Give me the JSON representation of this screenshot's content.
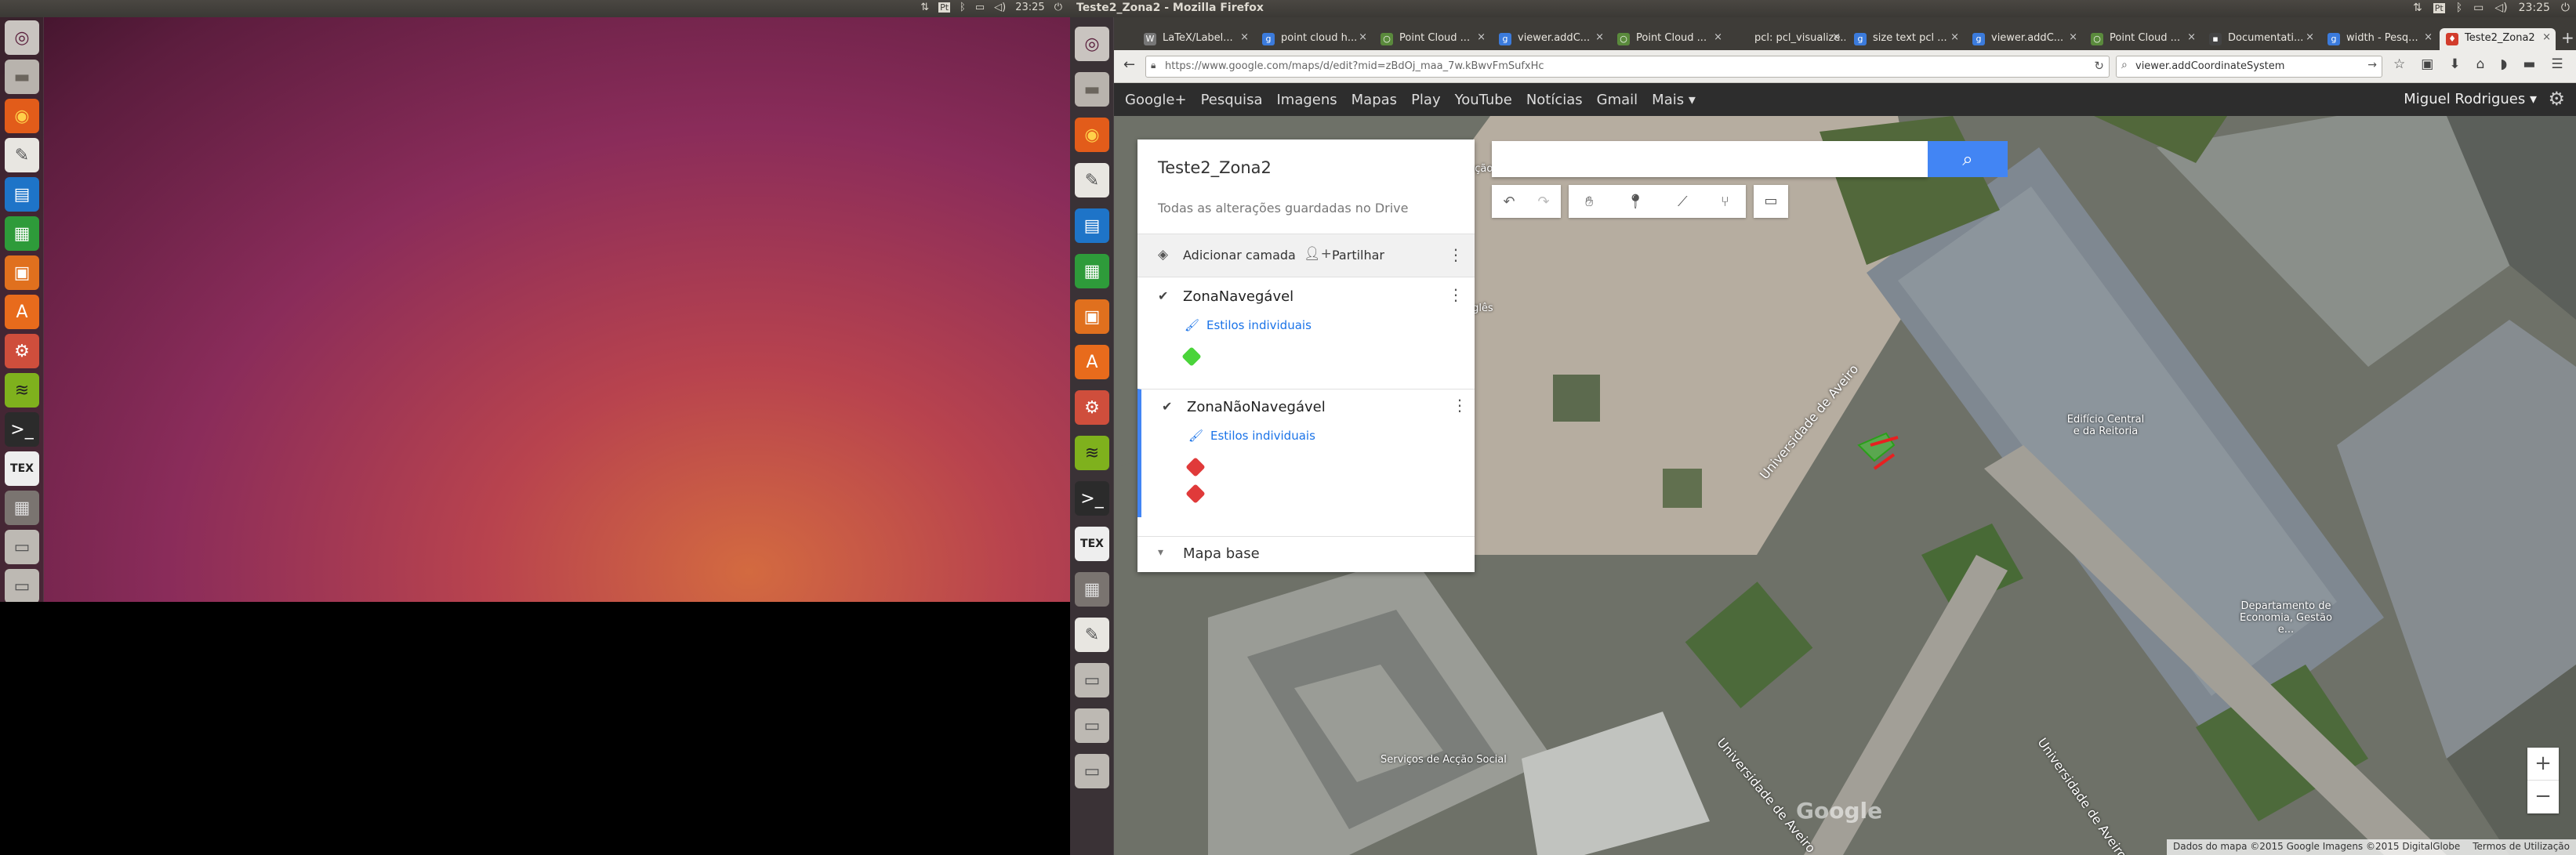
{
  "top_panel_left": {
    "time": "23:25"
  },
  "top_panel_right": {
    "window_title": "Teste2_Zona2 - Mozilla Firefox",
    "time": "23:25"
  },
  "launcher_left": [
    {
      "name": "dash-icon",
      "glyph": "◎",
      "bg": "#c9c4c0",
      "fg": "#5a1f3c"
    },
    {
      "name": "files-icon",
      "glyph": "▬",
      "bg": "#b8b3ad",
      "fg": "#6b655d"
    },
    {
      "name": "firefox-icon",
      "glyph": "◉",
      "bg": "#e25c1a",
      "fg": "#ffd04a"
    },
    {
      "name": "text-editor-icon",
      "glyph": "✎",
      "bg": "#e8e6e1",
      "fg": "#555"
    },
    {
      "name": "writer-icon",
      "glyph": "▤",
      "bg": "#1e74c8",
      "fg": "#fff"
    },
    {
      "name": "calc-icon",
      "glyph": "▦",
      "bg": "#2e9b3a",
      "fg": "#fff"
    },
    {
      "name": "impress-icon",
      "glyph": "▣",
      "bg": "#e0701e",
      "fg": "#fff"
    },
    {
      "name": "software-center-icon",
      "glyph": "A",
      "bg": "#e86b1c",
      "fg": "#fff"
    },
    {
      "name": "settings-icon",
      "glyph": "⚙",
      "bg": "#cf4e3c",
      "fg": "#fff"
    },
    {
      "name": "spotify-icon",
      "glyph": "≋",
      "bg": "#7fb11d",
      "fg": "#222"
    },
    {
      "name": "terminal-icon",
      "glyph": ">_",
      "bg": "#2b2b2b",
      "fg": "#fff"
    },
    {
      "name": "texmaker-icon",
      "glyph": "TEX",
      "bg": "#eeeeee",
      "fg": "#222"
    },
    {
      "name": "workspace-switcher-icon",
      "glyph": "▦",
      "bg": "#7a7470",
      "fg": "#ddd"
    },
    {
      "name": "drive-icon",
      "glyph": "▭",
      "bg": "#bdb9b3",
      "fg": "#555"
    },
    {
      "name": "drive-icon-2",
      "glyph": "▭",
      "bg": "#bdb9b3",
      "fg": "#555"
    }
  ],
  "launcher_right": [
    {
      "name": "dash-icon",
      "glyph": "◎",
      "bg": "#c9c4c0",
      "fg": "#5a1f3c"
    },
    {
      "name": "files-icon",
      "glyph": "▬",
      "bg": "#b8b3ad",
      "fg": "#6b655d"
    },
    {
      "name": "firefox-icon",
      "glyph": "◉",
      "bg": "#e25c1a",
      "fg": "#ffd04a"
    },
    {
      "name": "text-editor-icon",
      "glyph": "✎",
      "bg": "#e8e6e1",
      "fg": "#555"
    },
    {
      "name": "writer-icon",
      "glyph": "▤",
      "bg": "#1e74c8",
      "fg": "#fff"
    },
    {
      "name": "calc-icon",
      "glyph": "▦",
      "bg": "#2e9b3a",
      "fg": "#fff"
    },
    {
      "name": "impress-icon",
      "glyph": "▣",
      "bg": "#e0701e",
      "fg": "#fff"
    },
    {
      "name": "software-center-icon",
      "glyph": "A",
      "bg": "#e86b1c",
      "fg": "#fff"
    },
    {
      "name": "settings-icon",
      "glyph": "⚙",
      "bg": "#cf4e3c",
      "fg": "#fff"
    },
    {
      "name": "spotify-icon",
      "glyph": "≋",
      "bg": "#7fb11d",
      "fg": "#222"
    },
    {
      "name": "terminal-icon",
      "glyph": ">_",
      "bg": "#2b2b2b",
      "fg": "#fff"
    },
    {
      "name": "texmaker-icon",
      "glyph": "TEX",
      "bg": "#eeeeee",
      "fg": "#222"
    },
    {
      "name": "workspace-switcher-icon",
      "glyph": "▦",
      "bg": "#7a7470",
      "fg": "#ddd"
    },
    {
      "name": "text-editor-icon-2",
      "glyph": "✎",
      "bg": "#e8e6e1",
      "fg": "#555"
    },
    {
      "name": "drive-icon",
      "glyph": "▭",
      "bg": "#bdb9b3",
      "fg": "#555"
    },
    {
      "name": "drive-icon-2",
      "glyph": "▭",
      "bg": "#bdb9b3",
      "fg": "#555"
    },
    {
      "name": "drive-icon-3",
      "glyph": "▭",
      "bg": "#bdb9b3",
      "fg": "#555"
    }
  ],
  "tabs": [
    {
      "label": "LaTeX/Label...",
      "fav": "W",
      "fav_bg": "#777"
    },
    {
      "label": "point cloud h...",
      "fav": "g",
      "fav_bg": "#3b7bdc"
    },
    {
      "label": "Point Cloud ...",
      "fav": "○",
      "fav_bg": "#5a8a3c"
    },
    {
      "label": "viewer.addC...",
      "fav": "g",
      "fav_bg": "#3b7bdc"
    },
    {
      "label": "Point Cloud ...",
      "fav": "○",
      "fav_bg": "#5a8a3c"
    },
    {
      "label": "pcl: pcl_visualize...",
      "fav": "",
      "fav_bg": "transparent"
    },
    {
      "label": "size text pcl ...",
      "fav": "g",
      "fav_bg": "#3b7bdc"
    },
    {
      "label": "viewer.addC...",
      "fav": "g",
      "fav_bg": "#3b7bdc"
    },
    {
      "label": "Point Cloud ...",
      "fav": "○",
      "fav_bg": "#5a8a3c"
    },
    {
      "label": "Documentati...",
      "fav": "▪",
      "fav_bg": "#444"
    },
    {
      "label": "width - Pesq...",
      "fav": "g",
      "fav_bg": "#3b7bdc"
    },
    {
      "label": "Teste2_Zona2",
      "fav": "♦",
      "fav_bg": "#d23c2c",
      "active": true
    }
  ],
  "navbar": {
    "url": "https://www.google.com/maps/d/edit?mid=zBdOj_maa_7w.kBwvFmSufxHc",
    "search": "viewer.addCoordinateSystem"
  },
  "google_bar": {
    "links": [
      "Google+",
      "Pesquisa",
      "Imagens",
      "Mapas",
      "Play",
      "YouTube",
      "Notícias",
      "Gmail",
      "Mais ▾"
    ],
    "user": "Miguel Rodrigues ▾"
  },
  "panel": {
    "title": "Teste2_Zona2",
    "saved_status": "Todas as alterações guardadas no Drive",
    "add_layer": "Adicionar camada",
    "share": "Partilhar",
    "layers": [
      {
        "name": "ZonaNavegável",
        "style": "Estilos individuais",
        "color": "#4ad43a",
        "shapes": 1
      },
      {
        "name": "ZonaNãoNavegável",
        "style": "Estilos individuais",
        "color": "#e03a3a",
        "shapes": 2
      }
    ],
    "base_map": "Mapa base"
  },
  "map_labels": {
    "central": "Edifício Central\ne da Reitoria",
    "dept": "Departamento de\nEconomia, Gestão e...",
    "social": "Serviços de Acção Social",
    "street1": "Universidade de Aveiro",
    "street2": "Universidade de Aveiro",
    "street3": "Universidade de Aveiro",
    "educacao": "de Educação",
    "ingles": "Inglês",
    "footer_data": "Dados do mapa ©2015 Google Imagens ©2015 DigitalGlobe",
    "footer_terms": "Termos de Utilização",
    "zoom_in": "+",
    "zoom_out": "−",
    "watermark": "Google"
  }
}
